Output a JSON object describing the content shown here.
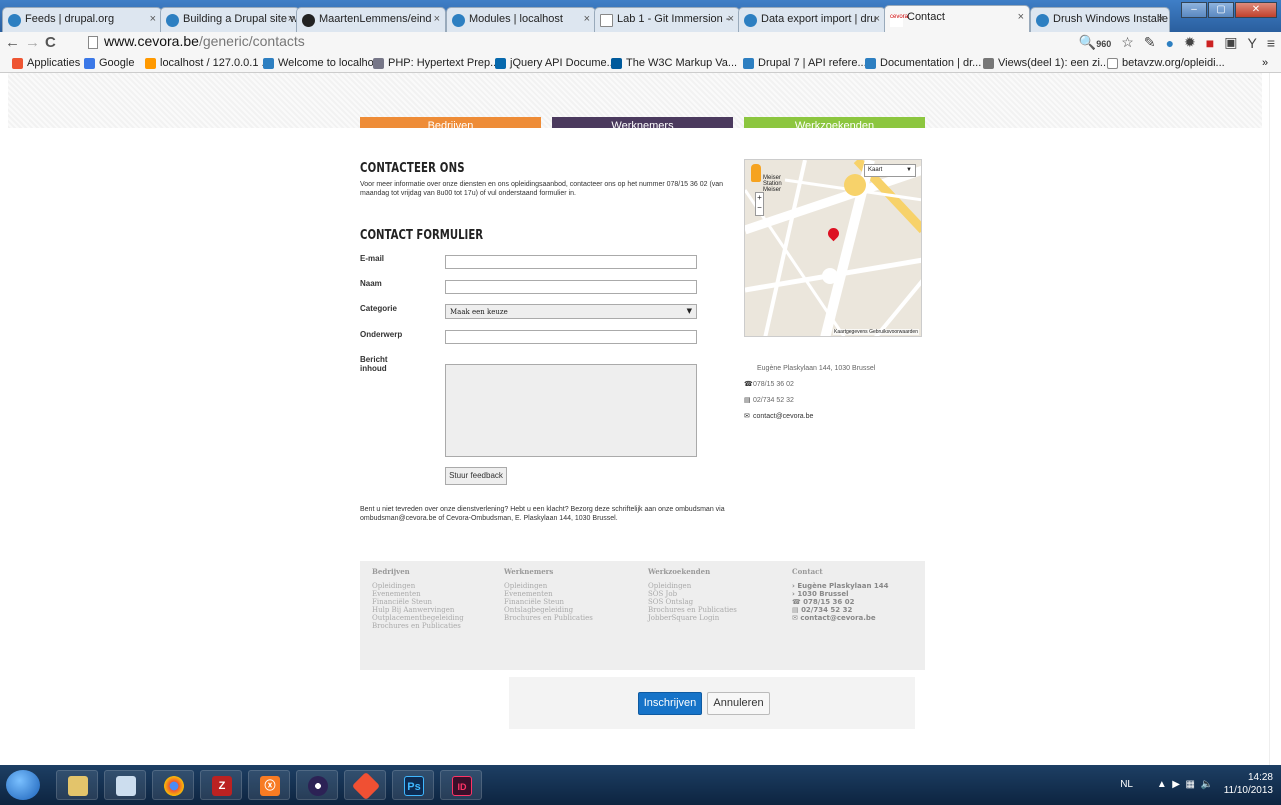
{
  "browser": {
    "tabs": [
      {
        "title": "Feeds | drupal.org",
        "favicon": "drupal-icon",
        "active": false
      },
      {
        "title": "Building a Drupal site w",
        "favicon": "drupal-icon",
        "active": false
      },
      {
        "title": "MaartenLemmens/eind",
        "favicon": "github-icon",
        "active": false
      },
      {
        "title": "Modules | localhost",
        "favicon": "drupal-icon",
        "active": false
      },
      {
        "title": "Lab 1 - Git Immersion -",
        "favicon": "document-icon",
        "active": false
      },
      {
        "title": "Data export import | dru",
        "favicon": "drupal-icon",
        "active": false
      },
      {
        "title": "Contact",
        "favicon": "cevora-icon",
        "active": true
      },
      {
        "title": "Drush Windows Installe",
        "favicon": "drupal-icon",
        "active": false
      }
    ],
    "tab_close": "×",
    "url_host": "www.cevora.be",
    "url_path": "/generic/contacts",
    "zoom_icon_text": "960",
    "bookmarks": [
      "Applicaties",
      "Google",
      "localhost / 127.0.0.1 ...",
      "Welcome to localho...",
      "PHP: Hypertext Prep...",
      "jQuery API Docume...",
      "The W3C Markup Va...",
      "Drupal 7 | API refere...",
      "Documentation | dr...",
      "Views(deel 1): een zi...",
      "betavzw.org/opleidi..."
    ],
    "bookmarks_overflow": "»"
  },
  "nav": {
    "tab1": "Bedrijven",
    "tab2": "Werknemers",
    "tab3": "Werkzoekenden",
    "colors": {
      "orange": "#ee8c37",
      "purple": "#4b3a5e",
      "green": "#8cc63f"
    }
  },
  "contact": {
    "heading": "CONTACTEER ONS",
    "intro": "Voor meer informatie over onze diensten en ons opleidingsaanbod, contacteer ons op het nummer 078/15 36 02 (van maandag tot vrijdag van 8u00 tot 17u) of vul onderstaand formulier in.",
    "form_heading": "CONTACT FORMULIER",
    "label_email": "E-mail",
    "label_name": "Naam",
    "label_category": "Categorie",
    "category_selected": "Maak een keuze",
    "label_subject": "Onderwerp",
    "label_message_1": "Bericht",
    "label_message_2": "inhoud",
    "submit": "Stuur feedback",
    "complaint": "Bent u niet tevreden over onze dienstverlening? Hebt u een klacht? Bezorg deze schriftelijk aan onze ombudsman via ombudsman@cevora.be of Cevora-Ombudsman, E. Plaskylaan 144, 1030 Brussel."
  },
  "map": {
    "type_selector": "Kaart",
    "station_1": "Meiser",
    "station_2": "Station",
    "station_3": "Meiser",
    "attribution": "Kaartgegevens  Gebruiksvoorwaarden"
  },
  "address": {
    "street": "Eugène Plaskylaan 144, 1030 Brussel",
    "phone": "078/15 36 02",
    "fax": "02/734 52 32",
    "email": "contact@cevora.be"
  },
  "footer": {
    "col1": {
      "head": "Bedrijven",
      "items": [
        "Opleidingen",
        "Evenementen",
        "Financiële Steun",
        "Hulp Bij Aanwervingen",
        "Outplacementbegeleiding",
        "Brochures en Publicaties"
      ]
    },
    "col2": {
      "head": "Werknemers",
      "items": [
        "Opleidingen",
        "Evenementen",
        "Financiële Steun",
        "Ontslagbegeleiding",
        "Brochures en Publicaties"
      ]
    },
    "col3": {
      "head": "Werkzoekenden",
      "items": [
        "Opleidingen",
        "SOS Job",
        "SOS Ontslag",
        "Brochures en Publicaties",
        "JobberSquare Login"
      ]
    },
    "col4": {
      "head": "Contact",
      "items": [
        "Eugène Plaskylaan 144",
        "1030 Brussel",
        "078/15 36 02",
        "02/734 52 32",
        "contact@cevora.be"
      ]
    }
  },
  "signup": {
    "primary": "Inschrijven",
    "secondary": "Annuleren"
  },
  "taskbar": {
    "apps": [
      "Ps",
      "ID"
    ],
    "lang": "NL",
    "time": "14:28",
    "date": "11/10/2013"
  }
}
